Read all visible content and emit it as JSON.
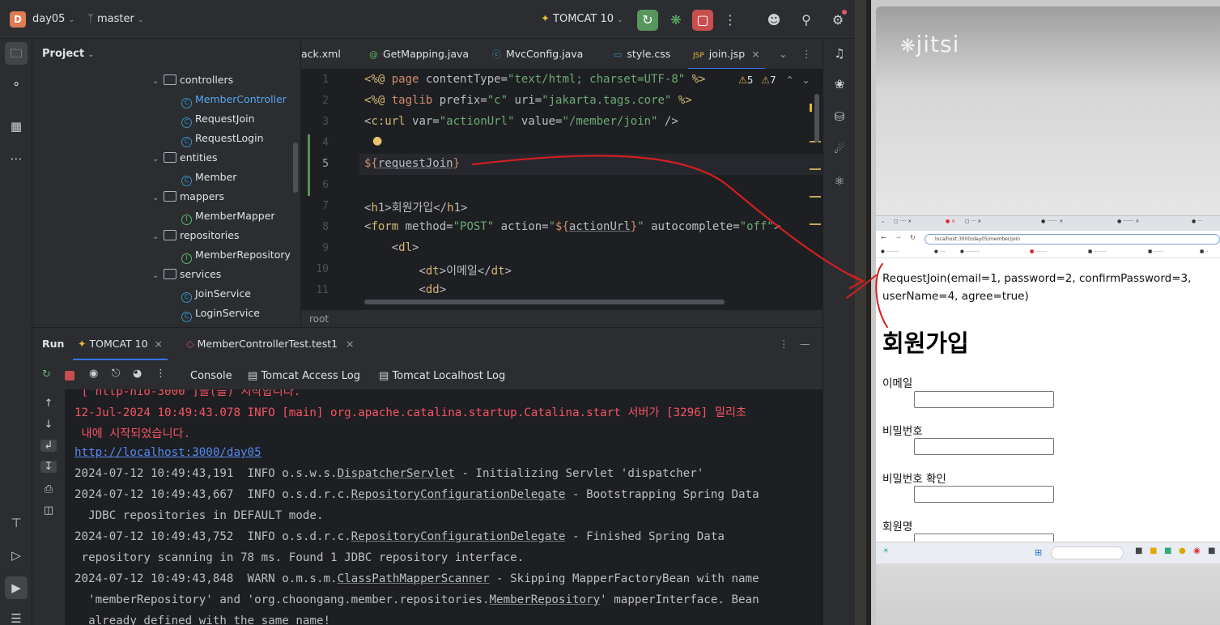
{
  "topbar": {
    "project_badge": "D",
    "project_name": "day05",
    "branch": "master",
    "run_config": "TOMCAT 10"
  },
  "project_panel": {
    "title": "Project",
    "tree": [
      {
        "label": "controllers",
        "kind": "folder",
        "depth": 0
      },
      {
        "label": "MemberController",
        "kind": "class",
        "depth": 1,
        "selected": true
      },
      {
        "label": "RequestJoin",
        "kind": "class",
        "depth": 1
      },
      {
        "label": "RequestLogin",
        "kind": "class",
        "depth": 1
      },
      {
        "label": "entities",
        "kind": "folder",
        "depth": 0
      },
      {
        "label": "Member",
        "kind": "class",
        "depth": 1
      },
      {
        "label": "mappers",
        "kind": "folder",
        "depth": 0
      },
      {
        "label": "MemberMapper",
        "kind": "interface",
        "depth": 1
      },
      {
        "label": "repositories",
        "kind": "folder",
        "depth": 0
      },
      {
        "label": "MemberRepository",
        "kind": "interface",
        "depth": 1
      },
      {
        "label": "services",
        "kind": "folder",
        "depth": 0
      },
      {
        "label": "JoinService",
        "kind": "class",
        "depth": 1
      },
      {
        "label": "LoginService",
        "kind": "class",
        "depth": 1
      }
    ]
  },
  "editor": {
    "tabs": [
      {
        "label": "ack.xml",
        "icon": "xml-icon"
      },
      {
        "label": "GetMapping.java",
        "icon": "annotation-icon"
      },
      {
        "label": "MvcConfig.java",
        "icon": "class-icon"
      },
      {
        "label": "style.css",
        "icon": "css-icon"
      },
      {
        "label": "join.jsp",
        "icon": "jsp-icon",
        "active": true
      }
    ],
    "inspections": {
      "warnings": "5",
      "weak_warnings": "7"
    },
    "line_numbers": [
      "1",
      "2",
      "3",
      "4",
      "5",
      "6",
      "7",
      "8",
      "9",
      "10",
      "11"
    ],
    "lines": [
      "<%@ page contentType=\"text/html; charset=UTF-8\" %>",
      "<%@ taglib prefix=\"c\" uri=\"jakarta.tags.core\" %>",
      "<c:url var=\"actionUrl\" value=\"/member/join\" />",
      "",
      "${requestJoin}",
      "",
      "<h1>회원가입</h1>",
      "<form method=\"POST\" action=\"${actionUrl}\" autocomplete=\"off\">",
      "    <dl>",
      "        <dt>이메일</dt>",
      "        <dd>"
    ],
    "breadcrumb": "root"
  },
  "run_panel": {
    "title": "Run",
    "tabs": [
      {
        "label": "TOMCAT 10",
        "active": true
      },
      {
        "label": "MemberControllerTest.test1"
      }
    ],
    "subtabs": [
      "Console",
      "Tomcat Access Log",
      "Tomcat Localhost Log"
    ],
    "console": [
      {
        "text": " [\"http-nio-3000\"]을(를) 시작합니다.",
        "style": "red"
      },
      {
        "text": "12-Jul-2024 10:49:43.078 INFO [main] org.apache.catalina.startup.Catalina.start 서버가 [3296] 밀리초",
        "style": "red"
      },
      {
        "text": " 내에 시작되었습니다.",
        "style": "red"
      },
      {
        "text": "http://localhost:3000/day05",
        "style": "link"
      },
      {
        "text": "2024-07-12 10:49:43,191  INFO o.s.w.s.DispatcherServlet - Initializing Servlet 'dispatcher'",
        "style": "normal"
      },
      {
        "text": "2024-07-12 10:49:43,667  INFO o.s.d.r.c.RepositoryConfigurationDelegate - Bootstrapping Spring Data",
        "style": "normal"
      },
      {
        "text": "  JDBC repositories in DEFAULT mode.",
        "style": "normal"
      },
      {
        "text": "2024-07-12 10:49:43,752  INFO o.s.d.r.c.RepositoryConfigurationDelegate - Finished Spring Data",
        "style": "normal"
      },
      {
        "text": " repository scanning in 78 ms. Found 1 JDBC repository interface.",
        "style": "normal"
      },
      {
        "text": "2024-07-12 10:49:43,848  WARN o.m.s.m.ClassPathMapperScanner - Skipping MapperFactoryBean with name",
        "style": "normal"
      },
      {
        "text": "  'memberRepository' and 'org.choongang.member.repositories.MemberRepository' mapperInterface. Bean",
        "style": "normal"
      },
      {
        "text": "  already defined with the same name!",
        "style": "normal"
      }
    ]
  },
  "shared_screen": {
    "logo": "jitsi",
    "browser_url": "localhost:3000/day05/member/join",
    "output_line1": "RequestJoin(email=1, password=2, confirmPassword=3,",
    "output_line2": "userName=4, agree=true)",
    "heading": "회원가입",
    "field_labels": [
      "이메일",
      "비밀번호",
      "비밀번호 확인",
      "회원명"
    ]
  },
  "colors": {
    "accent": "#3574f0",
    "annotation": "#d21f1f",
    "console_error": "#f75464"
  }
}
